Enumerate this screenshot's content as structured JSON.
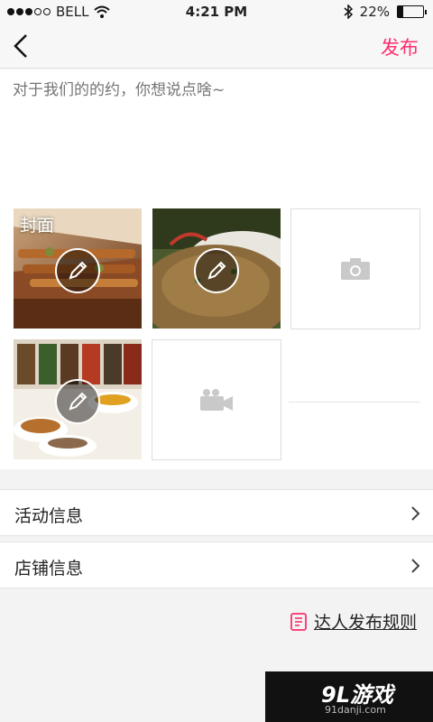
{
  "status_bar": {
    "carrier": "BELL",
    "time": "4:21 PM",
    "battery": "22%",
    "battery_level": 0.22,
    "signal_bars_filled": 3,
    "signal_bars_total": 5
  },
  "nav": {
    "back_icon": "chevron-left-icon",
    "publish_label": "发布",
    "accent_color": "#ff2e6e"
  },
  "composer": {
    "placeholder": "对于我们的的约，你想说点啥~",
    "cover_label": "封面"
  },
  "media": {
    "photos": [
      {
        "name": "photo-skewers",
        "is_cover": true
      },
      {
        "name": "photo-rice-dish",
        "is_cover": false
      },
      {
        "name": "photo-spices",
        "is_cover": false
      }
    ],
    "add_photo_icon": "camera-icon",
    "add_video_icon": "video-camera-icon",
    "edit_icon": "pencil-icon"
  },
  "sections": [
    {
      "label": "活动信息"
    },
    {
      "label": "店铺信息"
    }
  ],
  "rules_link": {
    "label": "达人发布规则",
    "icon": "document-icon"
  },
  "watermark": {
    "brand": "9L游戏",
    "url": "91danji.com"
  }
}
